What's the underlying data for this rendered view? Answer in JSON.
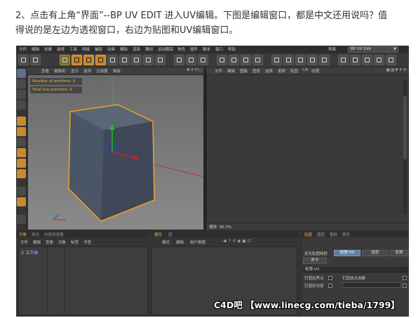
{
  "caption": {
    "line1": "2、点击有上角“界面”--BP UV EDIT 进入UV编辑。下图是编辑窗口，都是中文还用说吗？值",
    "line2": "得说的是左边为透视窗口，右边为贴图和UV编辑窗口。"
  },
  "main_menu": [
    "文件",
    "编辑",
    "创建",
    "选择",
    "工具",
    "网格",
    "捕捉",
    "动画",
    "模拟",
    "渲染",
    "雕刻",
    "运动跟踪",
    "角色",
    "插件",
    "脚本",
    "窗口",
    "帮助"
  ],
  "layout": {
    "label": "界面",
    "value": "BP UV Edit"
  },
  "viewport": {
    "menu": [
      "查看",
      "摄像机",
      "显示",
      "选项",
      "过滤器",
      "面板"
    ],
    "hud_emitters": "Number of emitters: 0",
    "hud_particles": "Total live particles: 0",
    "colors": {
      "cube": "#4a5566",
      "outline": "#f0a020",
      "axis_x": "#d02020",
      "axis_y": "#20c020",
      "axis_z": "#2050e0"
    }
  },
  "uv_editor": {
    "menu": [
      "文件",
      "编辑",
      "图像",
      "图层",
      "选择",
      "笔刷",
      "贴图",
      "UV",
      "纹理"
    ],
    "zoom": "缩放: 96.3%"
  },
  "object_manager": {
    "tabs": [
      "对象",
      "场次",
      "内容浏览器"
    ],
    "menu": [
      "文件",
      "编辑",
      "查看",
      "对象",
      "标签",
      "书签"
    ],
    "object_name": "立方体"
  },
  "attribute_manager": {
    "tabs": [
      "属性",
      "层"
    ],
    "menu": [
      "模式",
      "编辑",
      "用户数据"
    ]
  },
  "uv_panel": {
    "tabs": [
      "贴图",
      "图层",
      "笔刷",
      "颜色"
    ],
    "row1_label": "优化贴图映射",
    "btn_relax": "松弛 UV",
    "btn_project": "投射",
    "btn_transform": "变换",
    "btn_command": "命令",
    "section": "松弛 UV",
    "opt1": "钉固边界点",
    "opt2": "钉固到邻居",
    "opt3": "钉固选点选集"
  },
  "watermark": "C4D吧 【www.linecg.com/tieba/1799】"
}
